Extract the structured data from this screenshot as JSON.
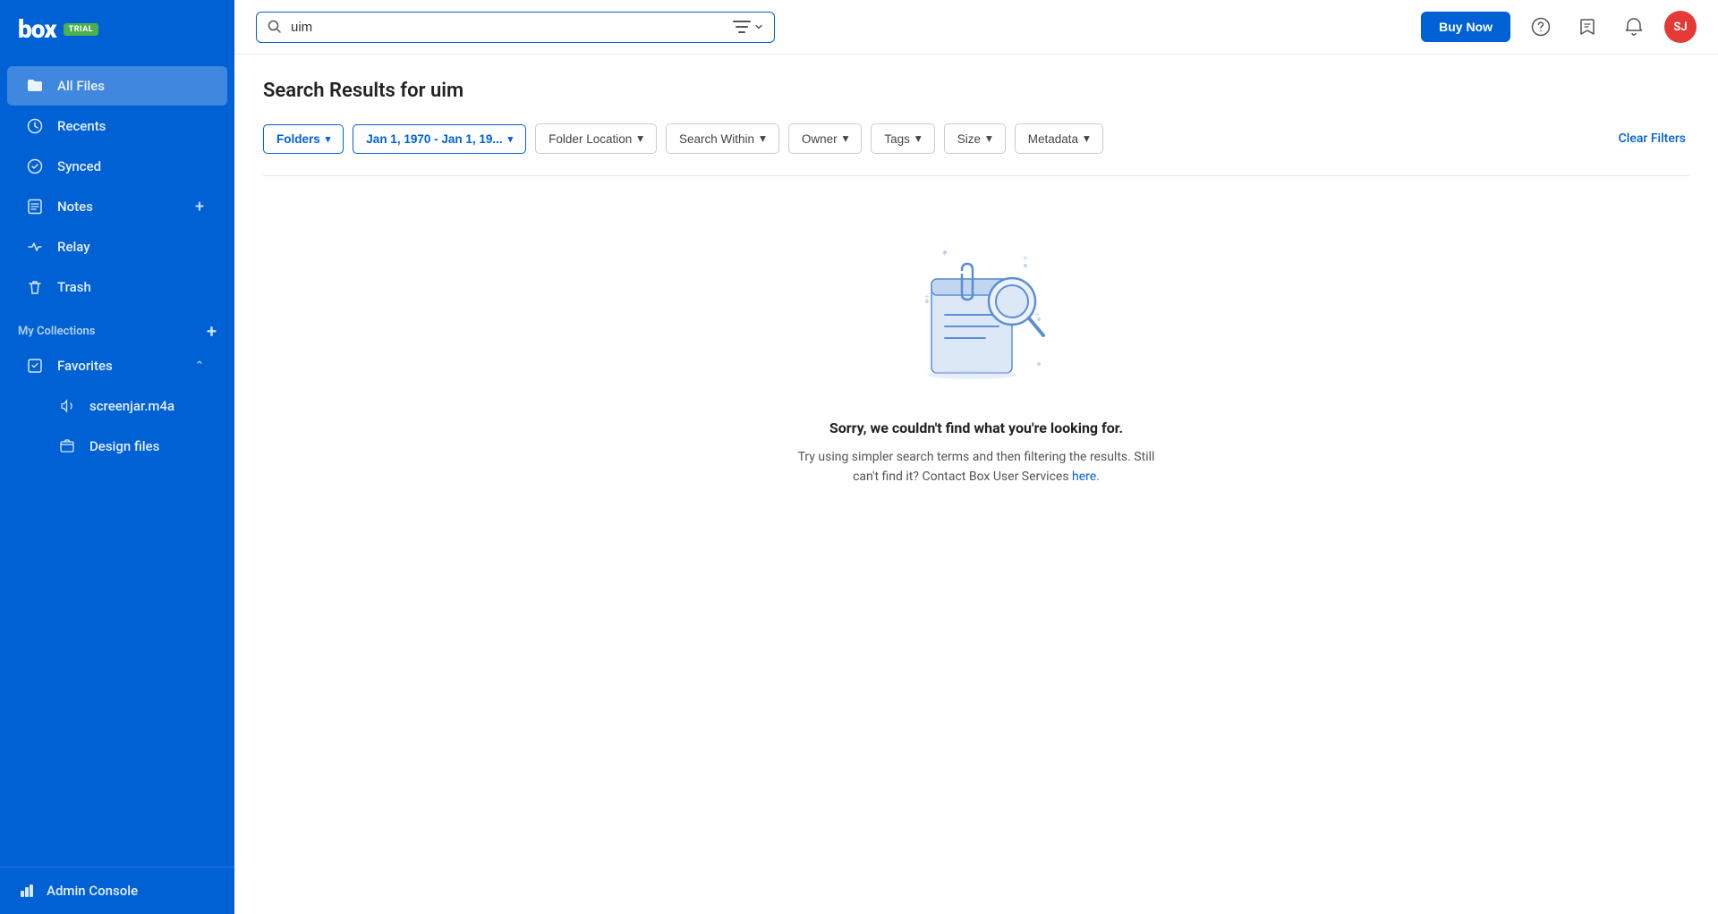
{
  "sidebar": {
    "logo_text": "box",
    "trial_badge": "TRIAL",
    "nav_items": [
      {
        "id": "all-files",
        "label": "All Files",
        "icon": "folder",
        "active": true
      },
      {
        "id": "recents",
        "label": "Recents",
        "icon": "clock",
        "active": false
      },
      {
        "id": "synced",
        "label": "Synced",
        "icon": "check-circle",
        "active": false
      },
      {
        "id": "notes",
        "label": "Notes",
        "icon": "note",
        "active": false,
        "has_plus": true
      },
      {
        "id": "relay",
        "label": "Relay",
        "icon": "relay",
        "active": false
      },
      {
        "id": "trash",
        "label": "Trash",
        "icon": "trash",
        "active": false
      }
    ],
    "collections_label": "My Collections",
    "favorites_label": "Favorites",
    "favorites_items": [
      {
        "id": "screenjar",
        "label": "screenjar.m4a",
        "icon": "audio"
      },
      {
        "id": "design-files",
        "label": "Design files",
        "icon": "folder-small"
      }
    ],
    "admin_console_label": "Admin Console"
  },
  "header": {
    "search_value": "uim",
    "search_placeholder": "Search",
    "buy_now_label": "Buy Now",
    "avatar_initials": "SJ"
  },
  "main": {
    "page_title": "Search Results for uim",
    "filters": {
      "folders_label": "Folders",
      "date_label": "Jan 1, 1970 - Jan 1, 19...",
      "folder_location_label": "Folder Location",
      "search_within_label": "Search Within",
      "owner_label": "Owner",
      "tags_label": "Tags",
      "size_label": "Size",
      "metadata_label": "Metadata",
      "clear_filters_label": "Clear Filters"
    },
    "empty_state": {
      "title": "Sorry, we couldn't find what you're looking for.",
      "description": "Try using simpler search terms and then filtering the results. Still can't find it? Contact Box User Services",
      "link_text": "here",
      "link_suffix": "."
    }
  }
}
